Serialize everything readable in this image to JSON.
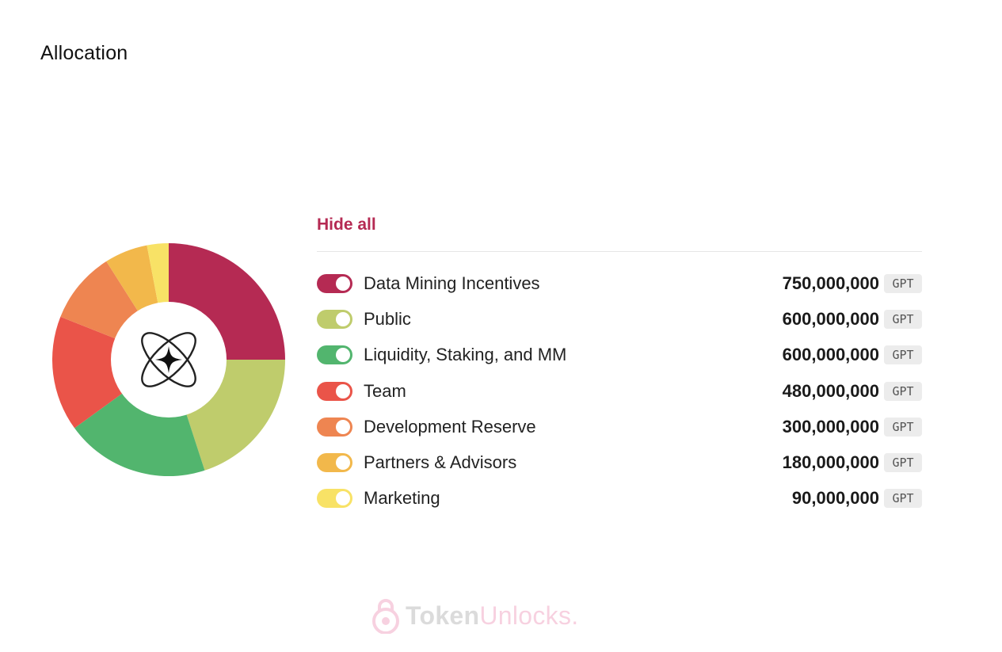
{
  "title": "Allocation",
  "hide_all_label": "Hide all",
  "watermark": {
    "brand_token": "Token",
    "brand_unlocks": "Unlocks",
    "dot": "."
  },
  "center_logo_icon": "atom-star-icon",
  "chart_data": {
    "type": "pie",
    "style": "donut",
    "unit": "GPT",
    "series": [
      {
        "name": "Data Mining Incentives",
        "value": 750000000,
        "display": "750,000,000",
        "color": "#b52a53"
      },
      {
        "name": "Public",
        "value": 600000000,
        "display": "600,000,000",
        "color": "#bfcc6c"
      },
      {
        "name": "Liquidity, Staking, and MM",
        "value": 600000000,
        "display": "600,000,000",
        "color": "#52b56e"
      },
      {
        "name": "Team",
        "value": 480000000,
        "display": "480,000,000",
        "color": "#ea5449"
      },
      {
        "name": "Development Reserve",
        "value": 300000000,
        "display": "300,000,000",
        "color": "#ee8551"
      },
      {
        "name": "Partners & Advisors",
        "value": 180000000,
        "display": "180,000,000",
        "color": "#f2b84b"
      },
      {
        "name": "Marketing",
        "value": 90000000,
        "display": "90,000,000",
        "color": "#f8e266"
      }
    ]
  }
}
